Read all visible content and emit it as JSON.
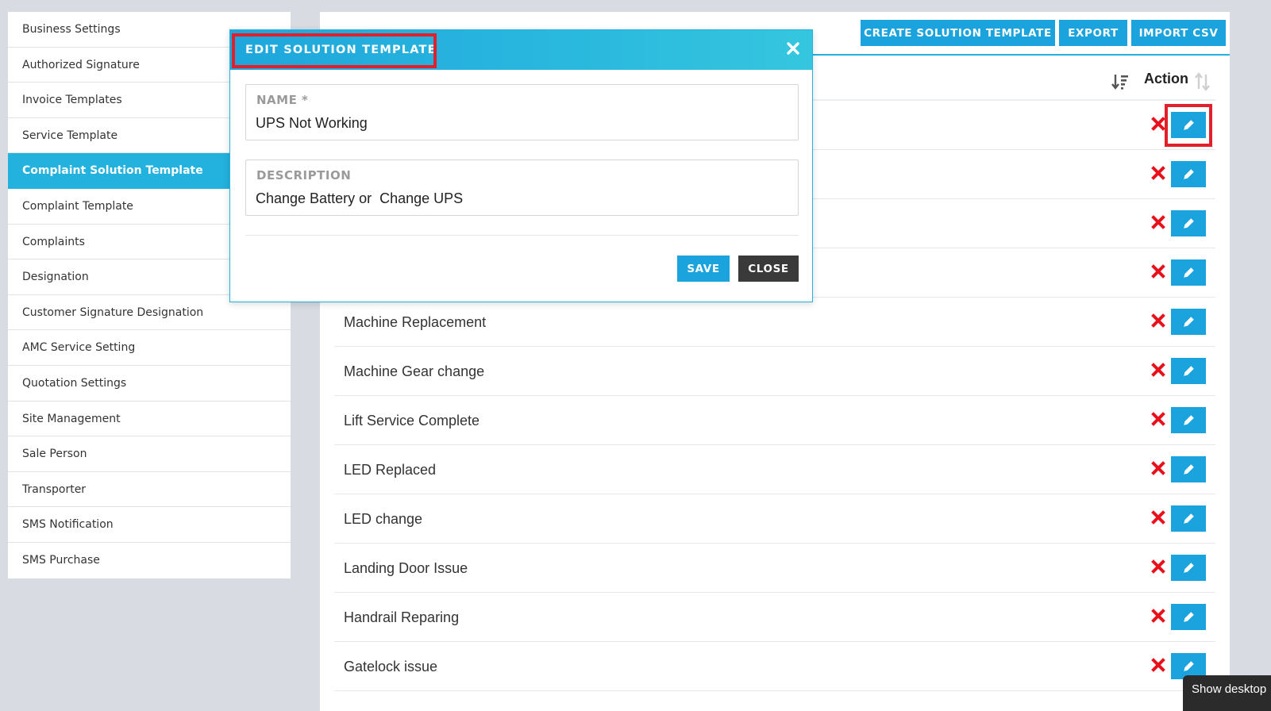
{
  "sidebar": {
    "items": [
      {
        "label": "Business Settings"
      },
      {
        "label": "Authorized Signature"
      },
      {
        "label": "Invoice Templates"
      },
      {
        "label": "Service Template"
      },
      {
        "label": "Complaint Solution Template",
        "active": true
      },
      {
        "label": "Complaint Template"
      },
      {
        "label": "Complaints"
      },
      {
        "label": "Designation"
      },
      {
        "label": "Customer Signature Designation"
      },
      {
        "label": "AMC Service Setting"
      },
      {
        "label": "Quotation Settings"
      },
      {
        "label": "Site Management"
      },
      {
        "label": "Sale Person"
      },
      {
        "label": "Transporter"
      },
      {
        "label": "SMS Notification"
      },
      {
        "label": "SMS Purchase"
      }
    ]
  },
  "toolbar": {
    "create_label": "CREATE SOLUTION TEMPLATE",
    "export_label": "EXPORT",
    "import_label": "IMPORT CSV"
  },
  "list": {
    "action_header": "Action",
    "rows": [
      {
        "label": ""
      },
      {
        "label": ""
      },
      {
        "label": ""
      },
      {
        "label": ""
      },
      {
        "label": "Machine Replacement"
      },
      {
        "label": "Machine Gear change"
      },
      {
        "label": "Lift Service Complete"
      },
      {
        "label": "LED Replaced"
      },
      {
        "label": "LED change"
      },
      {
        "label": "Landing Door Issue"
      },
      {
        "label": "Handrail Reparing"
      },
      {
        "label": "Gatelock issue"
      }
    ]
  },
  "modal": {
    "title": "EDIT SOLUTION TEMPLATE",
    "name_label": "NAME *",
    "name_value": "UPS Not Working",
    "description_label": "DESCRIPTION",
    "description_value": "Change Battery or  Change UPS",
    "save_label": "SAVE",
    "close_label": "CLOSE"
  },
  "tooltip": {
    "text": "Show desktop"
  },
  "colors": {
    "accent": "#1ba3dd",
    "active_sidebar": "#23b1dd",
    "delete": "#e8101a",
    "highlight": "#e2202b",
    "close_button": "#3a3a3a"
  },
  "icons": {
    "delete": "x-icon",
    "edit": "pencil-icon",
    "modal_close": "close-icon",
    "sort": "sort-icon"
  }
}
